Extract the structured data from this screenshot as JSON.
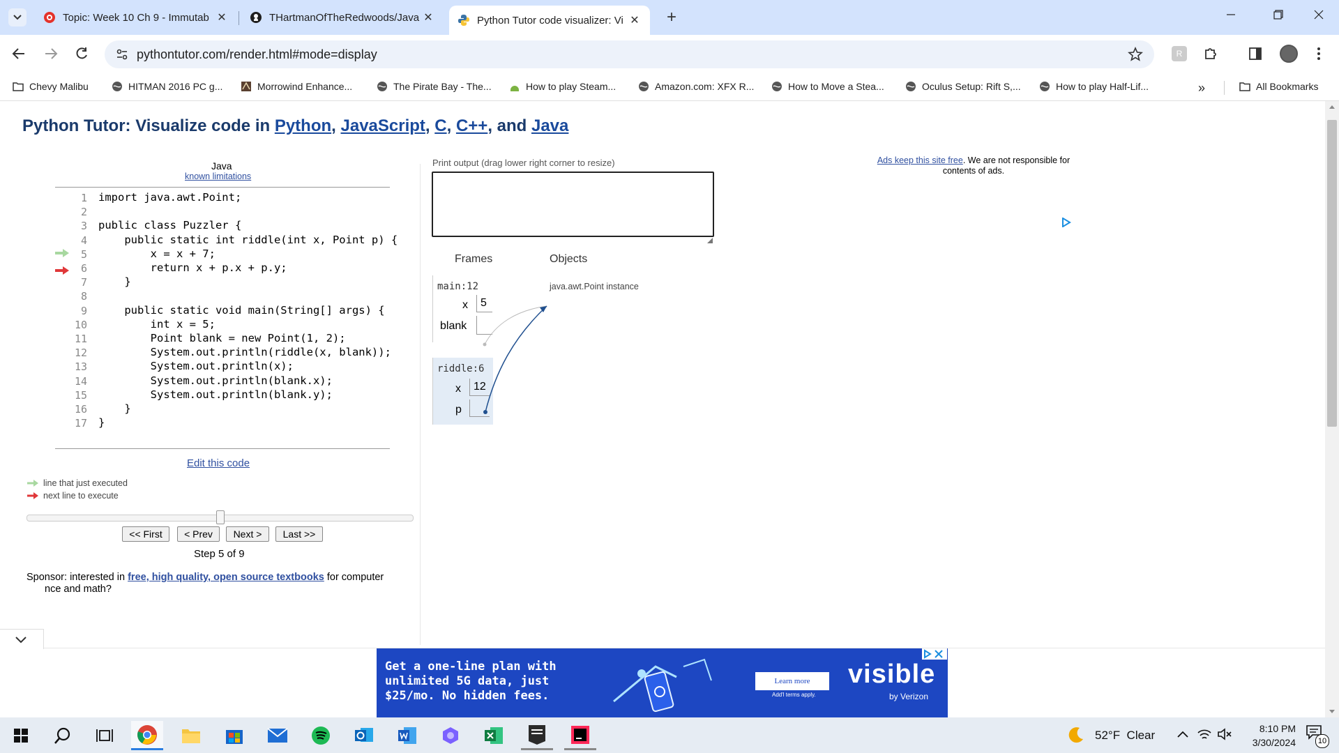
{
  "tabs": [
    {
      "title": "Topic: Week 10 Ch 9 - Immutab",
      "icon": "canvas-icon"
    },
    {
      "title": "THartmanOfTheRedwoods/Java",
      "icon": "github-icon"
    },
    {
      "title": "Python Tutor code visualizer: Vi",
      "icon": "python-icon",
      "active": true
    }
  ],
  "toolbar": {
    "url": "pythontutor.com/render.html#mode=display"
  },
  "bookmarks": [
    "Chevy Malibu",
    "HITMAN 2016 PC g...",
    "Morrowind Enhance...",
    "The Pirate Bay - The...",
    "How to play Steam...",
    "Amazon.com: XFX R...",
    "How to Move a Stea...",
    "Oculus Setup: Rift S,...",
    "How to play Half-Lif..."
  ],
  "all_bookmarks": "All Bookmarks",
  "header": {
    "prefix": "Python Tutor: Visualize code in ",
    "langs": [
      "Python",
      "JavaScript",
      "C",
      "C++",
      "Java"
    ],
    "sep1": ", ",
    "and": ", and "
  },
  "code_panel": {
    "language": "Java",
    "limitations": "known limitations",
    "lines": [
      "import java.awt.Point;",
      "",
      "public class Puzzler {",
      "    public static int riddle(int x, Point p) {",
      "        x = x + 7;",
      "        return x + p.x + p.y;",
      "    }",
      "",
      "    public static void main(String[] args) {",
      "        int x = 5;",
      "        Point blank = new Point(1, 2);",
      "        System.out.println(riddle(x, blank));",
      "        System.out.println(x);",
      "        System.out.println(blank.x);",
      "        System.out.println(blank.y);",
      "    }",
      "}"
    ],
    "line_numbers": [
      "1",
      "2",
      "3",
      "4",
      "5",
      "6",
      "7",
      "8",
      "9",
      "10",
      "11",
      "12",
      "13",
      "14",
      "15",
      "16",
      "17"
    ],
    "executed_line": 5,
    "next_line": 6,
    "edit_link": "Edit this code",
    "legend_executed": "line that just executed",
    "legend_next": "next line to execute",
    "buttons": {
      "first": "<< First",
      "prev": "< Prev",
      "next": "Next >",
      "last": "Last >>"
    },
    "step": "Step 5 of 9",
    "slider_position": 0.5,
    "sponsor_prefix": "Sponsor: interested in ",
    "sponsor_link": "free, high quality, open source textbooks",
    "sponsor_suffix": " for computer",
    "sponsor_line2": "nce and math?"
  },
  "viz": {
    "print_output_label": "Print output (drag lower right corner to resize)",
    "frames_label": "Frames",
    "objects_label": "Objects",
    "frames": [
      {
        "name": "main:12",
        "vars": [
          {
            "name": "x",
            "value": "5"
          },
          {
            "name": "blank",
            "value": ""
          }
        ]
      },
      {
        "name": "riddle:6",
        "vars": [
          {
            "name": "x",
            "value": "12"
          },
          {
            "name": "p",
            "value": ""
          }
        ]
      }
    ],
    "object_label": "java.awt.Point instance"
  },
  "ads": {
    "keep_free_link": "Ads keep this site free",
    "keep_free_text": ". We are not responsible for",
    "keep_free_line2": "contents of ads.",
    "banner_text": [
      "Get a one-line plan with",
      "unlimited 5G data, just",
      "$25/mo. No hidden fees."
    ],
    "banner_button": "Learn more",
    "banner_fine": "Add'l terms apply.",
    "banner_brand": "visible",
    "banner_by": "by Verizon"
  },
  "taskbar": {
    "weather": "52°F  Clear",
    "time": "8:10 PM",
    "date": "3/30/2024",
    "notifications": "10"
  },
  "colors": {
    "accent_green": "#a8d8a0",
    "accent_red": "#e0383a",
    "header_blue": "#1a3a6b",
    "tabstrip": "#d3e3fd"
  }
}
